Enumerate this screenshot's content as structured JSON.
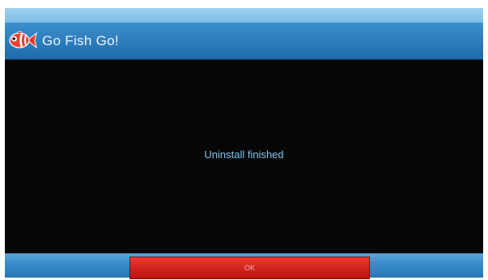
{
  "app": {
    "title": "Go Fish Go!",
    "icon": "clownfish-icon"
  },
  "dialog": {
    "message": "Uninstall finished",
    "ok_label": "OK"
  },
  "colors": {
    "title_bar": "#2f7fbf",
    "content_bg": "#070707",
    "message_text": "#7fc2ef",
    "button": "#d1211d"
  }
}
